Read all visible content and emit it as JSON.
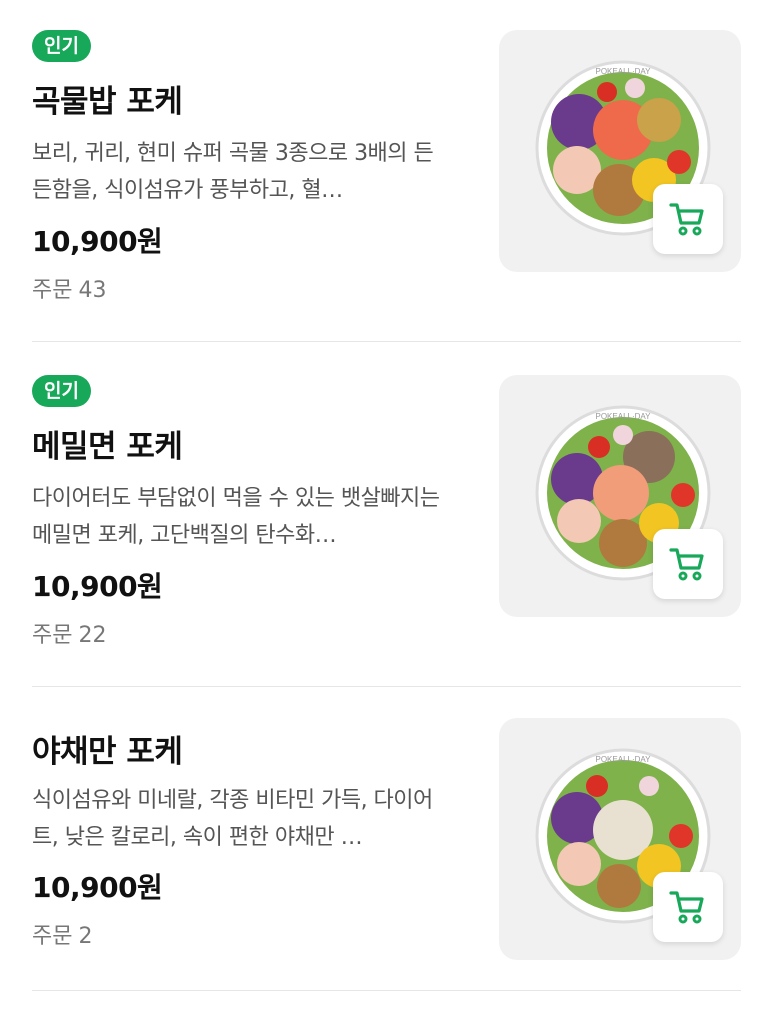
{
  "theme": {
    "accent": "#18a85a",
    "text": "#111111",
    "muted": "#555555",
    "divider": "#e6e6e6"
  },
  "items": [
    {
      "badge": "인기",
      "name": "곡물밥 포케",
      "description": "보리, 귀리, 현미 슈퍼 곡물 3종으로 3배의 든든함을, 식이섬유가 풍부하고, 혈…",
      "price": "10,900원",
      "orders_label": "주문",
      "orders_count": "43",
      "bowl_text": "POKEALL·DAY",
      "cart_icon": "cart-icon"
    },
    {
      "badge": "인기",
      "name": "메밀면 포케",
      "description": "다이어터도 부담없이 먹을 수 있는 뱃살빠지는 메밀면 포케, 고단백질의 탄수화…",
      "price": "10,900원",
      "orders_label": "주문",
      "orders_count": "22",
      "bowl_text": "POKEALL·DAY",
      "cart_icon": "cart-icon"
    },
    {
      "badge": "",
      "name": "야채만 포케",
      "description": "식이섬유와 미네랄, 각종 비타민 가득, 다이어트, 낮은 칼로리, 속이 편한 야채만 …",
      "price": "10,900원",
      "orders_label": "주문",
      "orders_count": "2",
      "bowl_text": "POKEALL·DAY",
      "cart_icon": "cart-icon"
    }
  ]
}
